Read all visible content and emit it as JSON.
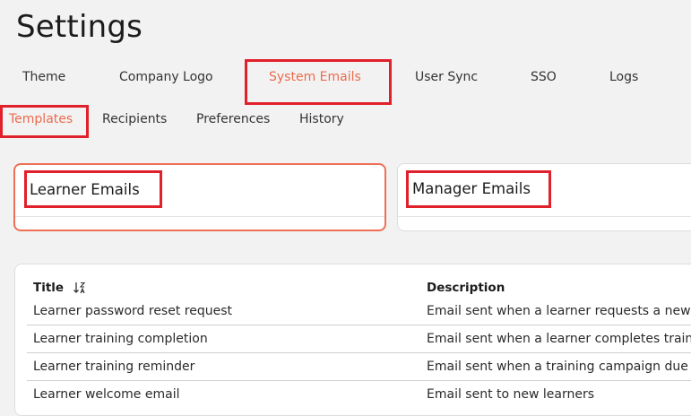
{
  "page": {
    "title": "Settings"
  },
  "primary_tabs": [
    {
      "label": "Theme",
      "active": false
    },
    {
      "label": "Company Logo",
      "active": false
    },
    {
      "label": "System Emails",
      "active": true
    },
    {
      "label": "User Sync",
      "active": false
    },
    {
      "label": "SSO",
      "active": false
    },
    {
      "label": "Logs",
      "active": false
    }
  ],
  "secondary_tabs": [
    {
      "label": "Templates",
      "active": true
    },
    {
      "label": "Recipients",
      "active": false
    },
    {
      "label": "Preferences",
      "active": false
    },
    {
      "label": "History",
      "active": false
    }
  ],
  "email_groups": [
    {
      "label": "Learner Emails",
      "selected": true
    },
    {
      "label": "Manager Emails",
      "selected": false
    }
  ],
  "table": {
    "columns": {
      "title": "Title",
      "description": "Description"
    },
    "rows": [
      {
        "title": "Learner password reset request",
        "description": "Email sent when a learner requests a new password"
      },
      {
        "title": "Learner training completion",
        "description": "Email sent when a learner completes training"
      },
      {
        "title": "Learner training reminder",
        "description": "Email sent when a training campaign due date approaches"
      },
      {
        "title": "Learner welcome email",
        "description": "Email sent to new learners"
      }
    ]
  },
  "colors": {
    "accent": "#ec6b4e",
    "highlight": "#e0202a",
    "background": "#f2f2f2"
  },
  "icons": {
    "sort": "sort-descending-icon"
  }
}
